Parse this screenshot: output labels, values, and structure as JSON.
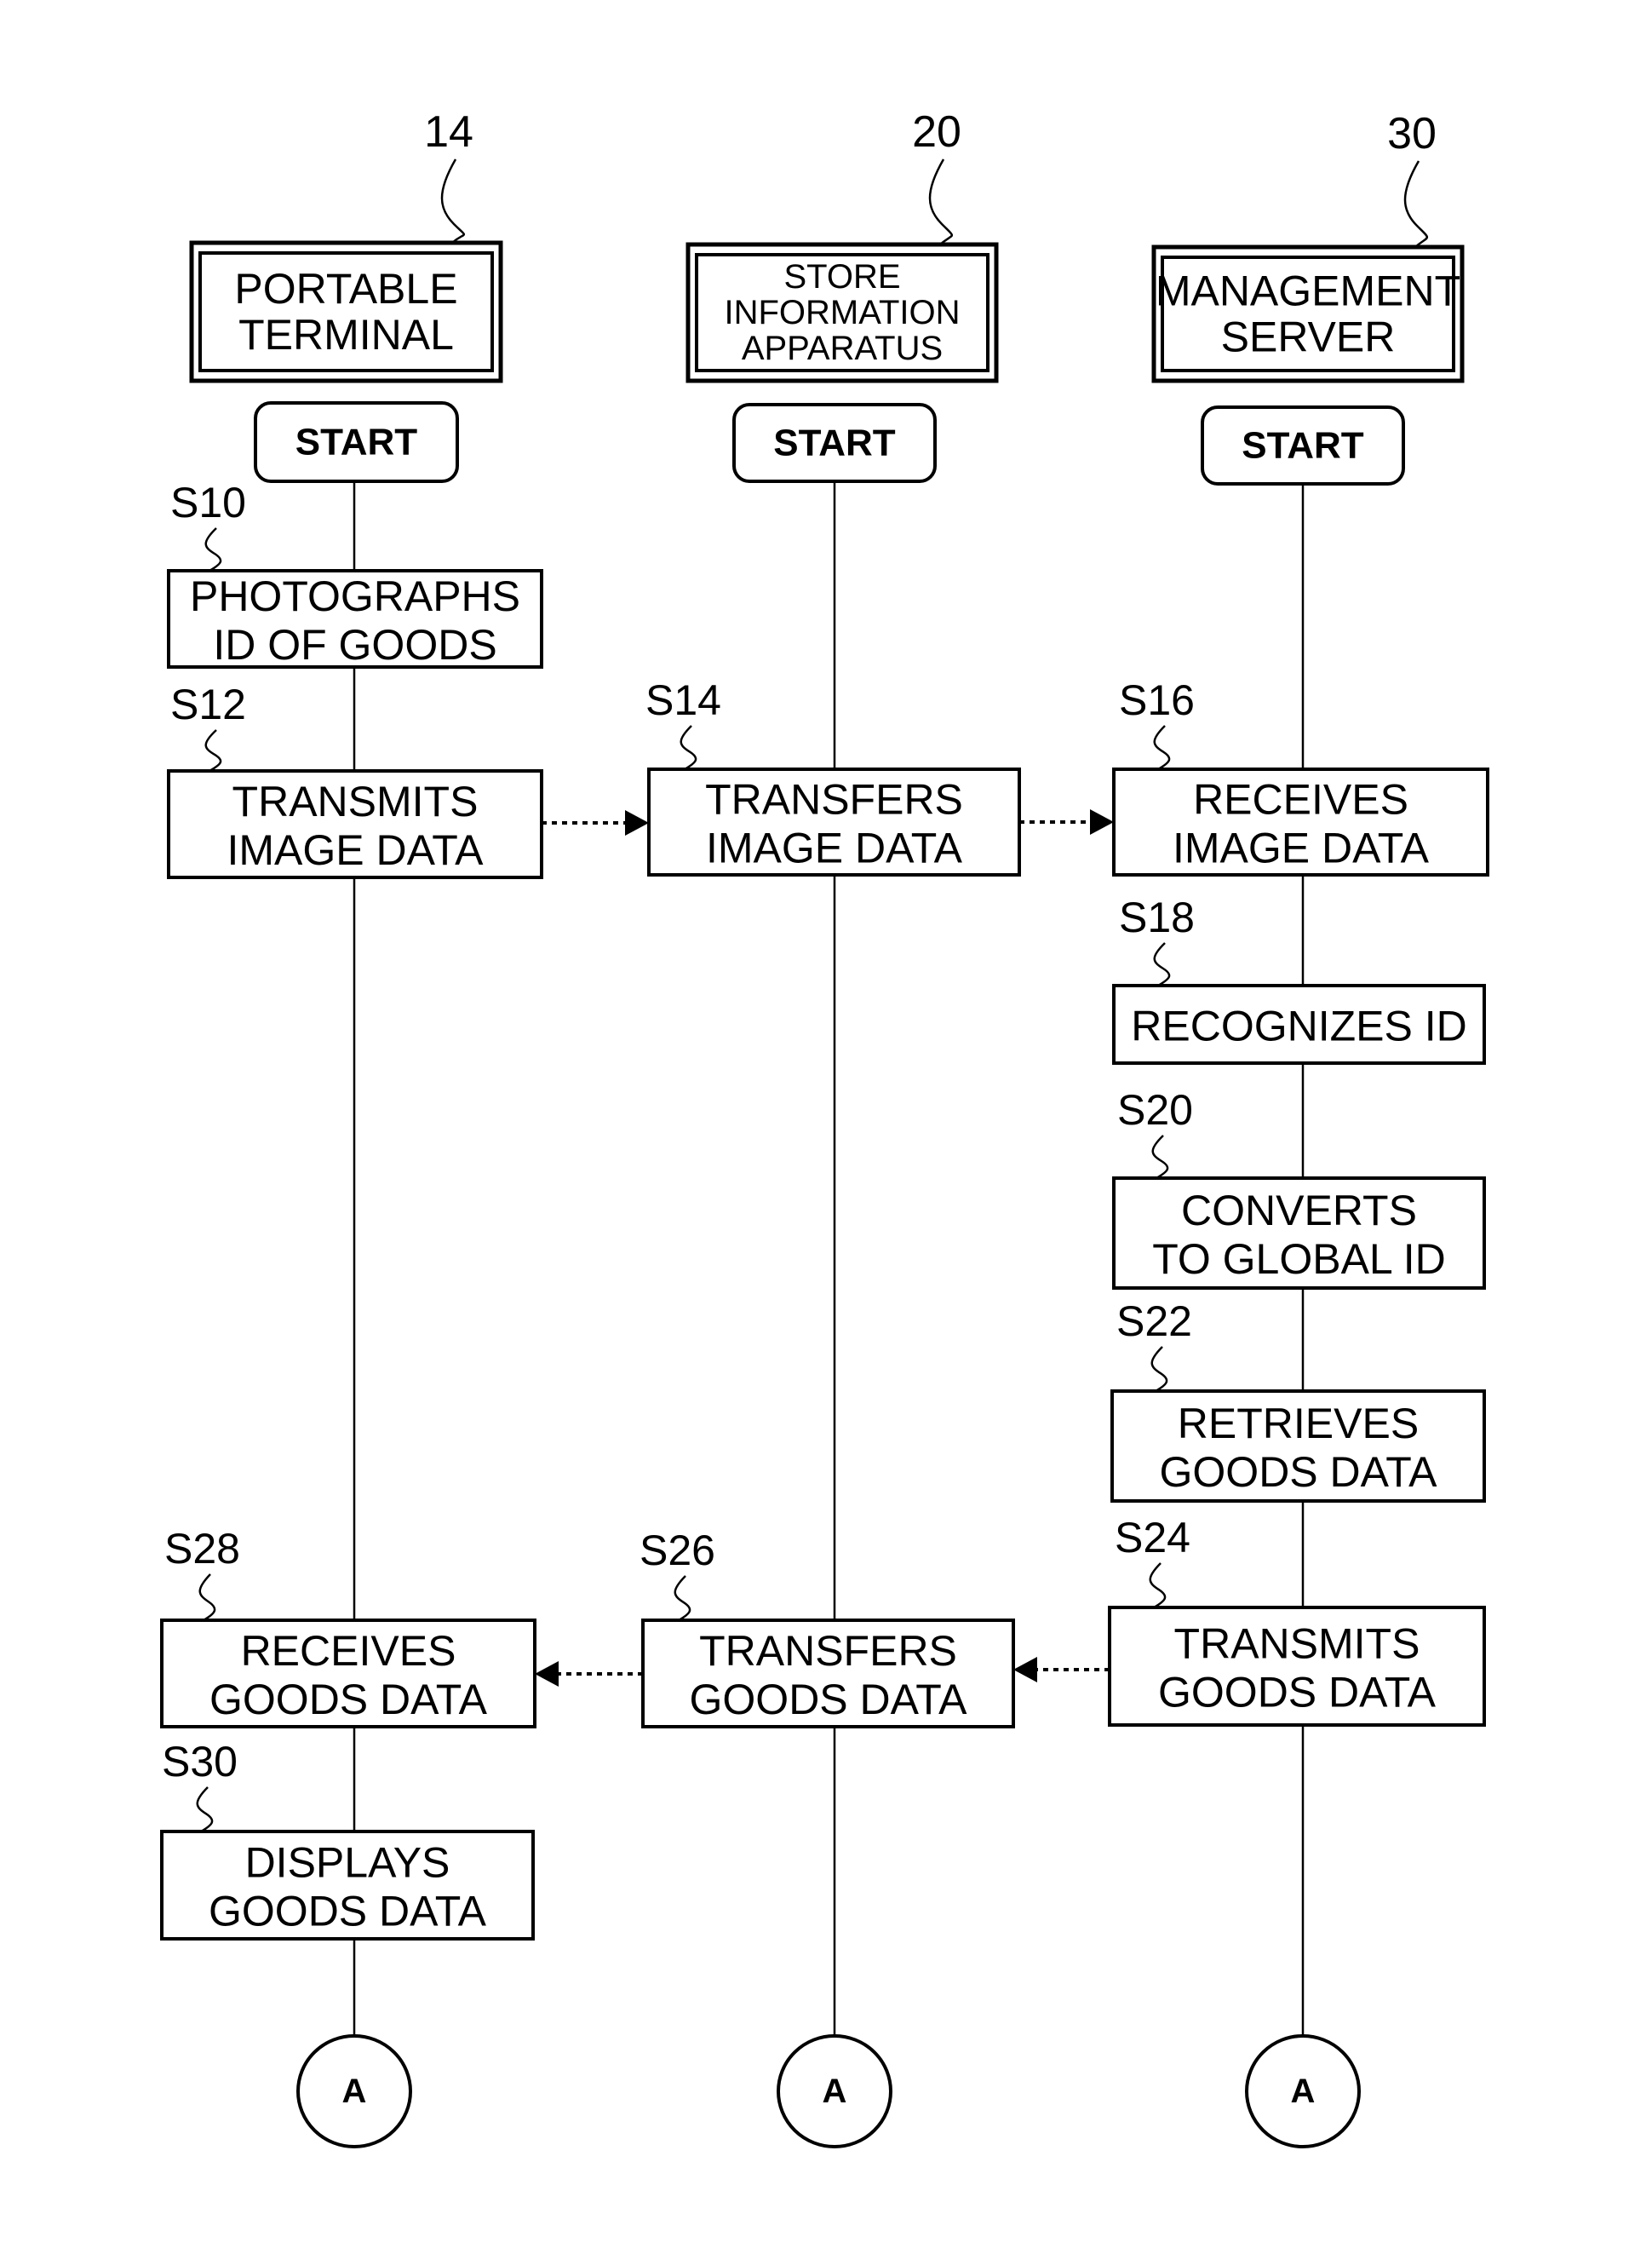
{
  "participants": [
    {
      "ref": "14",
      "label_lines": [
        "PORTABLE",
        "TERMINAL"
      ],
      "start": "START",
      "connector": "A"
    },
    {
      "ref": "20",
      "label_lines": [
        "STORE",
        "INFORMATION",
        "APPARATUS"
      ],
      "start": "START",
      "connector": "A"
    },
    {
      "ref": "30",
      "label_lines": [
        "MANAGEMENT",
        "SERVER"
      ],
      "start": "START",
      "connector": "A"
    }
  ],
  "steps": [
    {
      "id": "S10",
      "lane": 0,
      "lines": [
        "PHOTOGRAPHS",
        "ID OF GOODS"
      ]
    },
    {
      "id": "S12",
      "lane": 0,
      "lines": [
        "TRANSMITS",
        "IMAGE DATA"
      ]
    },
    {
      "id": "S14",
      "lane": 1,
      "lines": [
        "TRANSFERS",
        "IMAGE DATA"
      ]
    },
    {
      "id": "S16",
      "lane": 2,
      "lines": [
        "RECEIVES",
        "IMAGE DATA"
      ]
    },
    {
      "id": "S18",
      "lane": 2,
      "lines": [
        "RECOGNIZES ID"
      ]
    },
    {
      "id": "S20",
      "lane": 2,
      "lines": [
        "CONVERTS",
        "TO GLOBAL ID"
      ]
    },
    {
      "id": "S22",
      "lane": 2,
      "lines": [
        "RETRIEVES",
        "GOODS DATA"
      ]
    },
    {
      "id": "S24",
      "lane": 2,
      "lines": [
        "TRANSMITS",
        "GOODS DATA"
      ]
    },
    {
      "id": "S26",
      "lane": 1,
      "lines": [
        "TRANSFERS",
        "GOODS DATA"
      ]
    },
    {
      "id": "S28",
      "lane": 0,
      "lines": [
        "RECEIVES",
        "GOODS DATA"
      ]
    },
    {
      "id": "S30",
      "lane": 0,
      "lines": [
        "DISPLAYS",
        "GOODS DATA"
      ]
    }
  ],
  "messages": [
    {
      "from": "S12",
      "to": "S14",
      "direction": "right",
      "style": "dotted"
    },
    {
      "from": "S14",
      "to": "S16",
      "direction": "right",
      "style": "dotted"
    },
    {
      "from": "S24",
      "to": "S26",
      "direction": "left",
      "style": "dotted"
    },
    {
      "from": "S26",
      "to": "S28",
      "direction": "left",
      "style": "dotted"
    }
  ]
}
